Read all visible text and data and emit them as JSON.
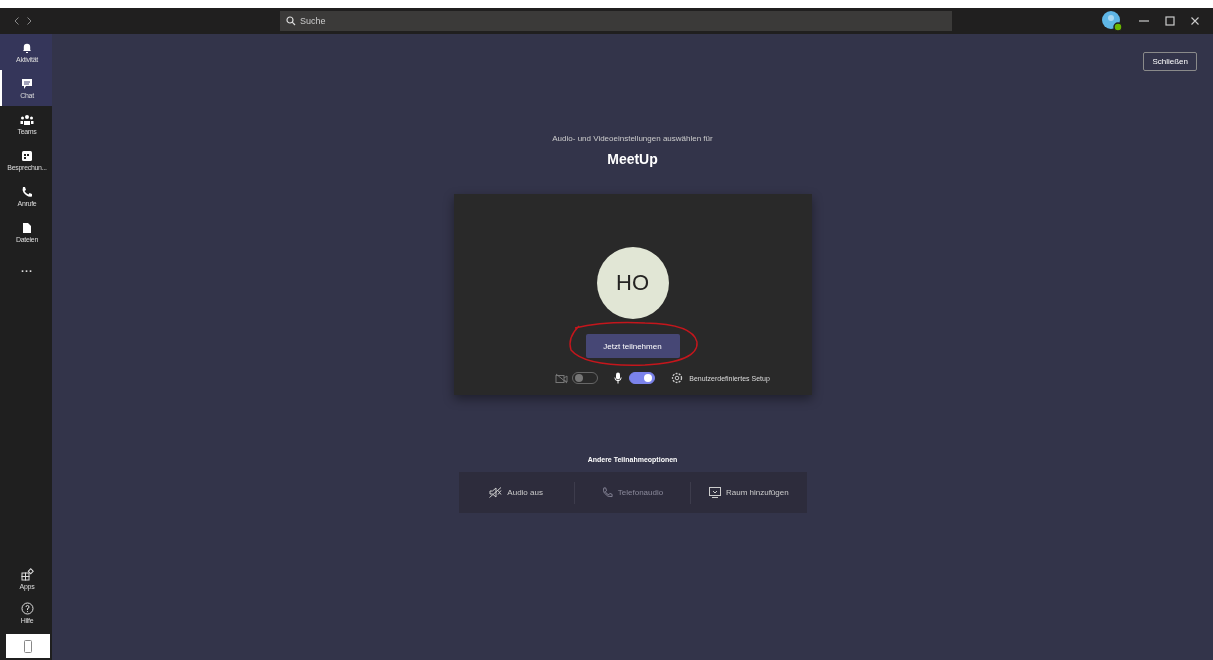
{
  "titlebar": {
    "search_placeholder": "Suche"
  },
  "sidebar": {
    "items": [
      {
        "label": "Aktivität",
        "selected": false,
        "highlighted": true
      },
      {
        "label": "Chat",
        "selected": true,
        "highlighted": true
      },
      {
        "label": "Teams",
        "selected": false,
        "highlighted": false
      },
      {
        "label": "Besprechun...",
        "selected": false,
        "highlighted": false
      },
      {
        "label": "Anrufe",
        "selected": false,
        "highlighted": false
      },
      {
        "label": "Dateien",
        "selected": false,
        "highlighted": false
      },
      {
        "label": "...",
        "selected": false,
        "highlighted": false
      }
    ],
    "bottom_items": [
      {
        "label": "Apps"
      },
      {
        "label": "Hilfe"
      }
    ]
  },
  "close_button": "Schließen",
  "heading": "Audio- und Videoeinstellungen auswählen für",
  "meeting_title": "MeetUp",
  "preview": {
    "avatar_initials": "HO",
    "join_button": "Jetzt teilnehmen",
    "camera_on": false,
    "mic_on": true,
    "setup_label": "Benutzerdefiniertes Setup"
  },
  "other_options": {
    "title": "Andere Teilnahmeoptionen",
    "items": [
      {
        "label": "Audio aus",
        "disabled": false
      },
      {
        "label": "Telefonaudio",
        "disabled": true
      },
      {
        "label": "Raum hinzufügen",
        "disabled": false
      }
    ]
  }
}
